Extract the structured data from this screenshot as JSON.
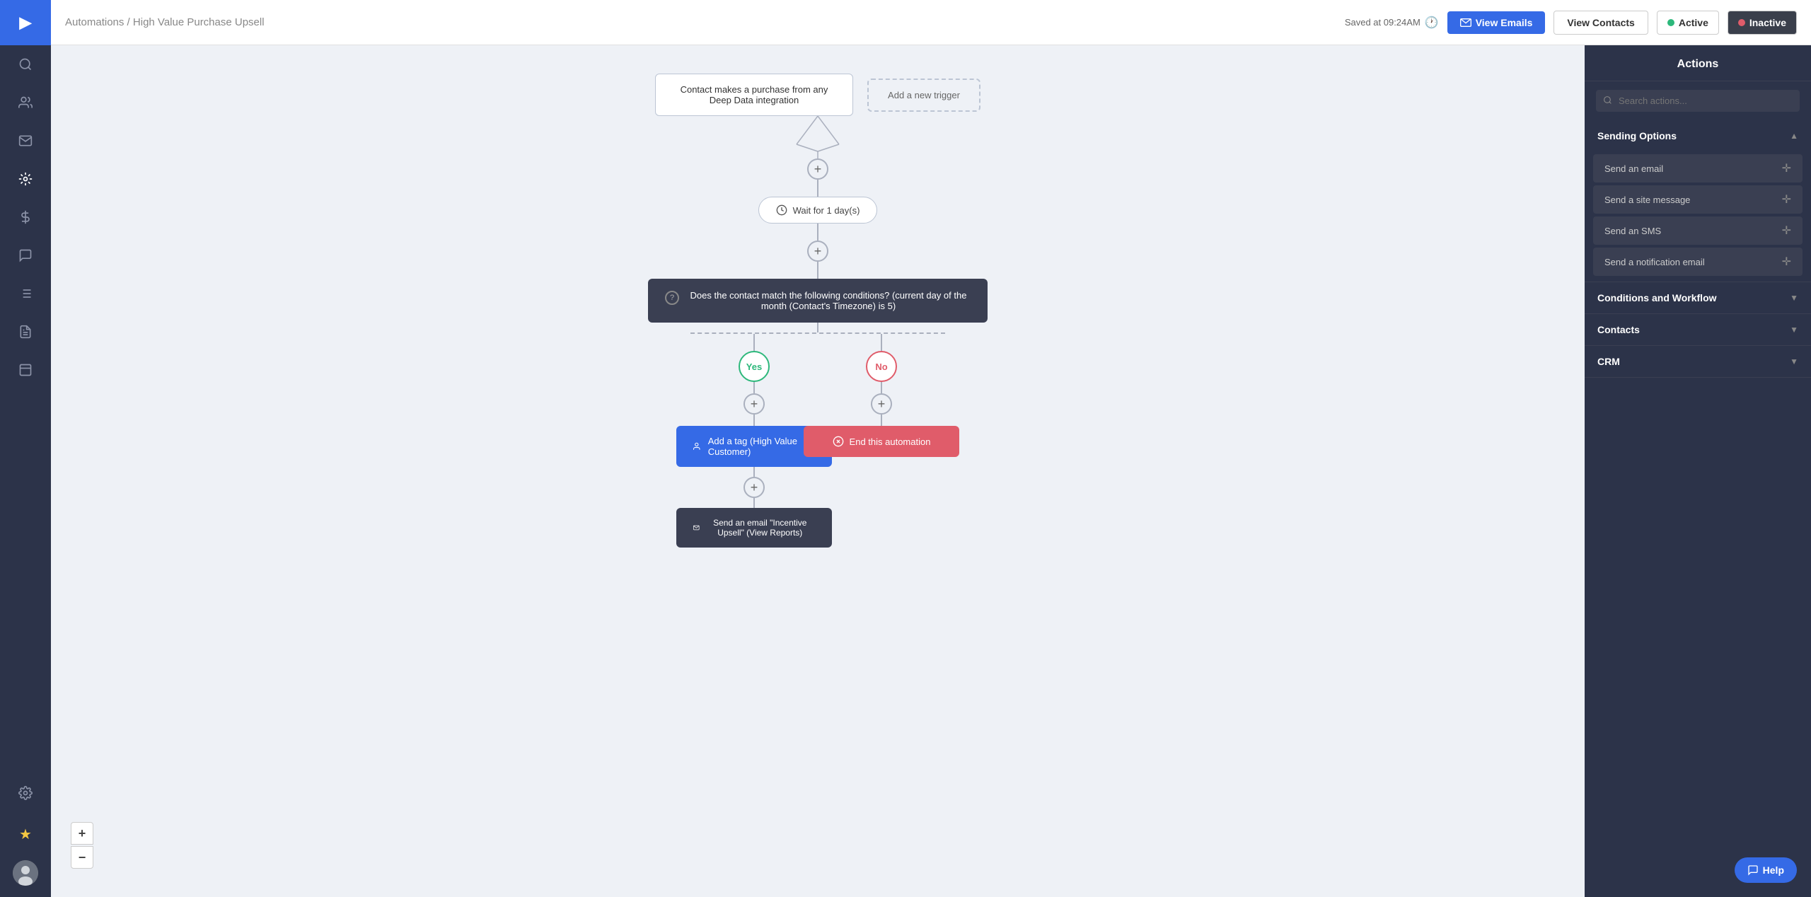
{
  "sidebar": {
    "logo": "▶",
    "items": [
      {
        "name": "search",
        "icon": "🔍"
      },
      {
        "name": "contacts",
        "icon": "👥"
      },
      {
        "name": "campaigns",
        "icon": "✉"
      },
      {
        "name": "automations",
        "icon": "⚙"
      },
      {
        "name": "deals",
        "icon": "💲"
      },
      {
        "name": "conversations",
        "icon": "💬"
      },
      {
        "name": "lists",
        "icon": "☰"
      },
      {
        "name": "reports",
        "icon": "📄"
      },
      {
        "name": "pages",
        "icon": "⬜"
      },
      {
        "name": "settings",
        "icon": "⚙"
      },
      {
        "name": "upgrade",
        "icon": "★"
      }
    ]
  },
  "topbar": {
    "breadcrumb_home": "Automations",
    "breadcrumb_separator": " / ",
    "breadcrumb_current": "High Value Purchase Upsell",
    "saved_label": "Saved at 09:24AM",
    "view_emails_label": "View Emails",
    "view_contacts_label": "View Contacts",
    "active_label": "Active",
    "inactive_label": "Inactive"
  },
  "canvas": {
    "trigger_label": "Contact makes a purchase from any Deep Data integration",
    "add_trigger_label": "Add a new trigger",
    "wait_label": "Wait for 1 day(s)",
    "condition_label": "Does the contact match the following conditions? (current day of the month (Contact's Timezone) is 5)",
    "yes_label": "Yes",
    "no_label": "No",
    "tag_label": "Add a tag (High Value Customer)",
    "email_label": "Send an email \"Incentive Upsell\" (View Reports)",
    "end_label": "End this automation"
  },
  "right_panel": {
    "title": "Actions",
    "search_placeholder": "Search actions...",
    "sections": [
      {
        "label": "Sending Options",
        "expanded": true,
        "items": [
          {
            "label": "Send an email"
          },
          {
            "label": "Send a site message"
          },
          {
            "label": "Send an SMS"
          },
          {
            "label": "Send a notification email"
          }
        ]
      },
      {
        "label": "Conditions and Workflow",
        "expanded": false,
        "items": []
      },
      {
        "label": "Contacts",
        "expanded": false,
        "items": []
      },
      {
        "label": "CRM",
        "expanded": false,
        "items": []
      }
    ],
    "help_label": "Help"
  },
  "zoom": {
    "plus": "+",
    "minus": "−"
  }
}
